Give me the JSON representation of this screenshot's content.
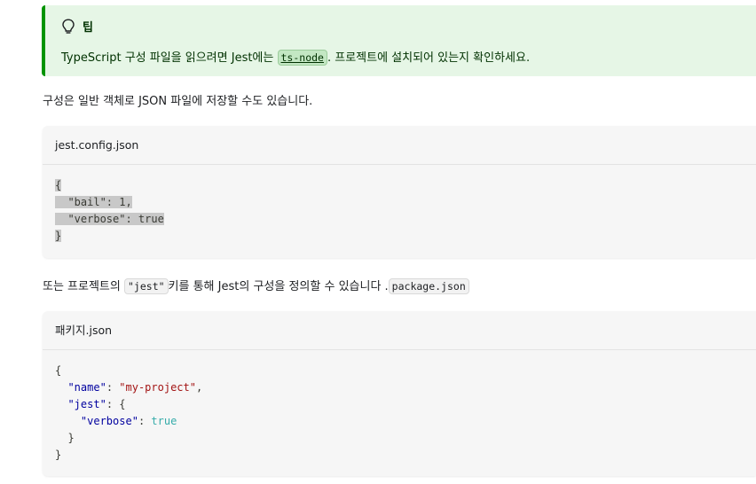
{
  "tip": {
    "icon": "lightbulb-icon",
    "title": "팁",
    "text_before": "TypeScript 구성 파일을 읽으려면 Jest에는 ",
    "code": "ts-node",
    "text_after": ". 프로젝트에 설치되어 있는지 확인하세요."
  },
  "para1": "구성은 일반 객체로 JSON 파일에 저장할 수도 있습니다.",
  "code1": {
    "title": "jest.config.json",
    "lines": [
      "{",
      "  \"bail\": 1,",
      "  \"verbose\": true",
      "}"
    ]
  },
  "para2": {
    "before": "또는 프로젝트의 ",
    "code1": "\"jest\"",
    "middle": "키를 통해 Jest의 구성을 정의할 수 있습니다 .",
    "code2": "package.json"
  },
  "code2": {
    "title": "패키지.json",
    "line1": "{",
    "line2_key": "\"name\"",
    "line2_sep": ": ",
    "line2_val": "\"my-project\"",
    "line2_end": ",",
    "line3_key": "\"jest\"",
    "line3_end": ": {",
    "line4_key": "\"verbose\"",
    "line4_sep": ": ",
    "line4_val": "true",
    "line5": "}",
    "line6": "}"
  },
  "colors": {
    "tip_bg": "#e6f6e6",
    "tip_border": "#009400",
    "code_bg": "#f6f6f6",
    "string": "#a31515",
    "boolean": "#36acaa"
  }
}
